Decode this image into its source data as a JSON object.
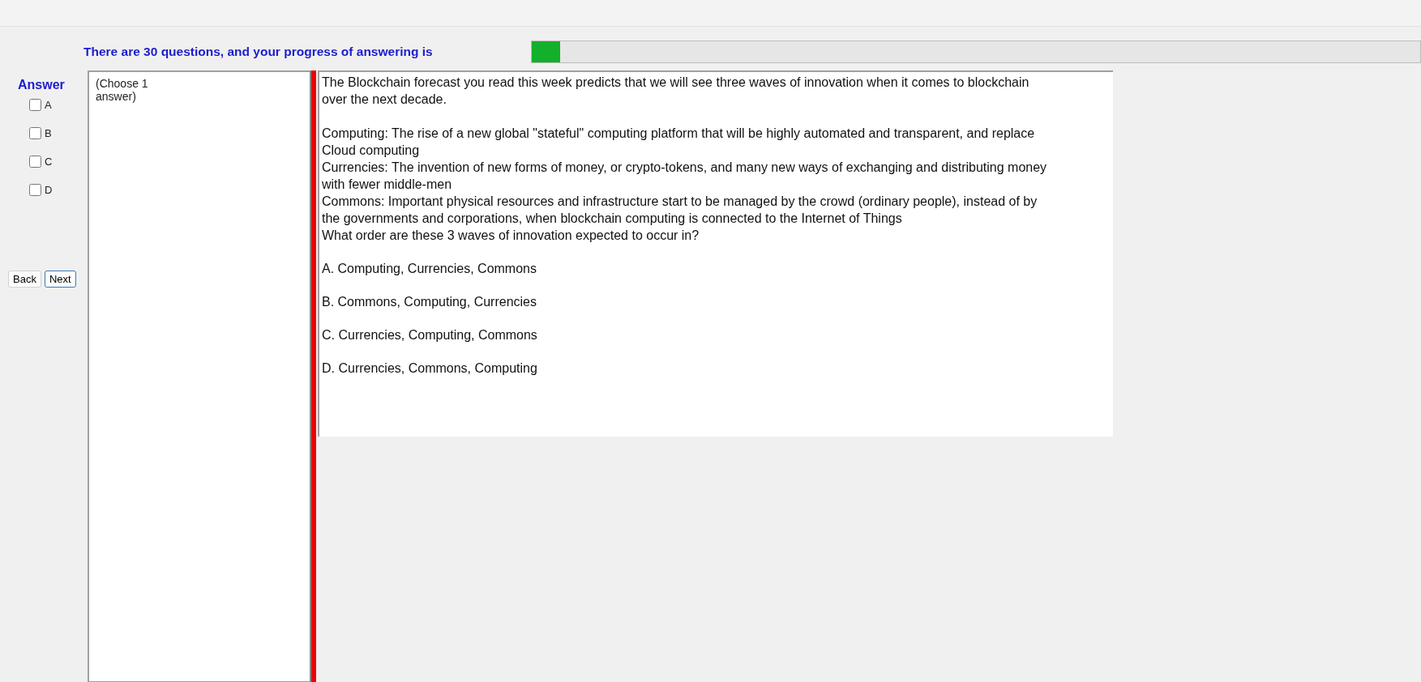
{
  "progress": {
    "label": "There are 30 questions, and your progress of answering is",
    "level": 0.032
  },
  "answer_panel": {
    "title": "Answer",
    "choices": [
      {
        "label": "A",
        "checked": false
      },
      {
        "label": "B",
        "checked": false
      },
      {
        "label": "C",
        "checked": false
      },
      {
        "label": "D",
        "checked": false
      }
    ],
    "buttons": [
      "Back",
      "Next"
    ]
  },
  "instruction": "(Choose 1 answer)",
  "question": {
    "intro": "The Blockchain forecast you read this week predicts that we will see three waves of innovation when it comes to blockchain over the next decade.",
    "points": [
      "Computing: The rise of a new global \"stateful\" computing platform that will be highly automated and transparent, and replace Cloud computing",
      "Currencies: The invention of new forms of money, or crypto-tokens, and many new ways of exchanging and distributing money with fewer middle-men",
      "Commons: Important physical resources and infrastructure start to be managed by the crowd (ordinary people), instead of by the governments and corporations, when blockchain computing is connected to the Internet of Things",
      "What order are these 3 waves of innovation expected to occur in?"
    ],
    "options": [
      "A.  Computing, Currencies, Commons",
      "B.  Commons, Computing, Currencies",
      "C.  Currencies, Computing, Commons",
      "D.  Currencies, Commons, Computing"
    ]
  }
}
